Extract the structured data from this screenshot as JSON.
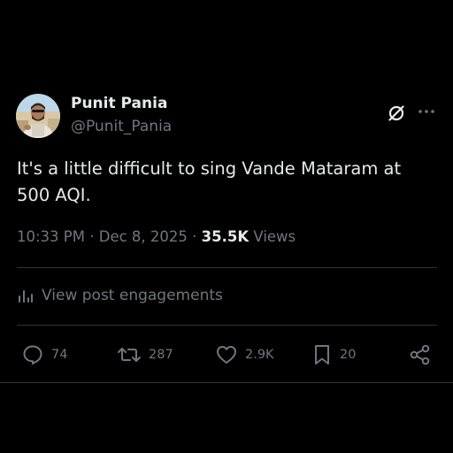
{
  "author": {
    "display_name": "Punit Pania",
    "handle": "@Punit_Pania"
  },
  "header_icons": {
    "grok": "grok-icon",
    "more": "more-icon"
  },
  "post": {
    "text": "It's a little difficult to sing Vande Mataram at 500 AQI."
  },
  "meta": {
    "time": "10:33 PM",
    "separator": "·",
    "date": "Dec 8, 2025",
    "views_count": "35.5K",
    "views_label": "Views"
  },
  "engagements": {
    "label": "View post engagements",
    "icon": "analytics-icon"
  },
  "actions": {
    "replies": "74",
    "reposts": "287",
    "likes": "2.9K",
    "bookmarks": "20"
  },
  "colors": {
    "background": "#000000",
    "primary_text": "#e7e9ea",
    "secondary_text": "#71767b",
    "divider": "#2f3336"
  }
}
